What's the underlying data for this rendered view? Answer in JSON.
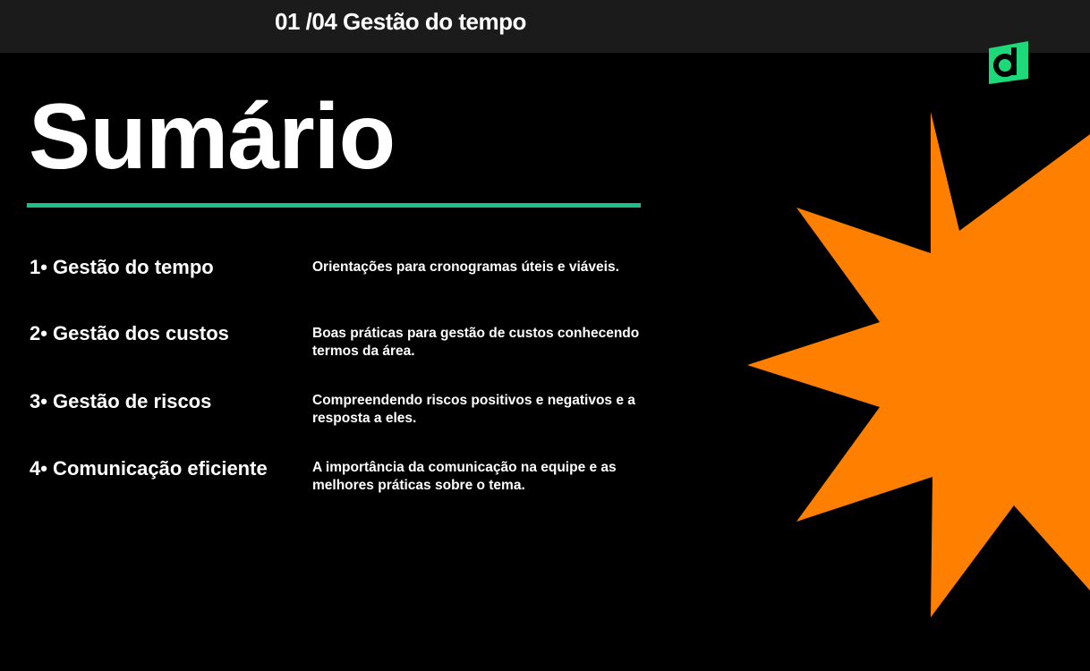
{
  "topbar": {
    "title": "01 /04 Gestão do tempo"
  },
  "logo": {
    "letter": "d",
    "color": "#1dd97a"
  },
  "slide": {
    "heading": "Sumário",
    "accent_color": "#1dbf86",
    "starburst_color": "#ff8000",
    "items": [
      {
        "title": "1• Gestão do tempo",
        "description": "Orientações para cronogramas úteis e viáveis."
      },
      {
        "title": "2• Gestão dos custos",
        "description": "Boas práticas para gestão de custos conhecendo termos da área."
      },
      {
        "title": "3• Gestão de riscos",
        "description": "Compreendendo riscos positivos e negativos e a resposta a eles."
      },
      {
        "title": "4• Comunicação eficiente",
        "description": "A importância da comunicação na equipe e as melhores práticas sobre o tema."
      }
    ]
  }
}
